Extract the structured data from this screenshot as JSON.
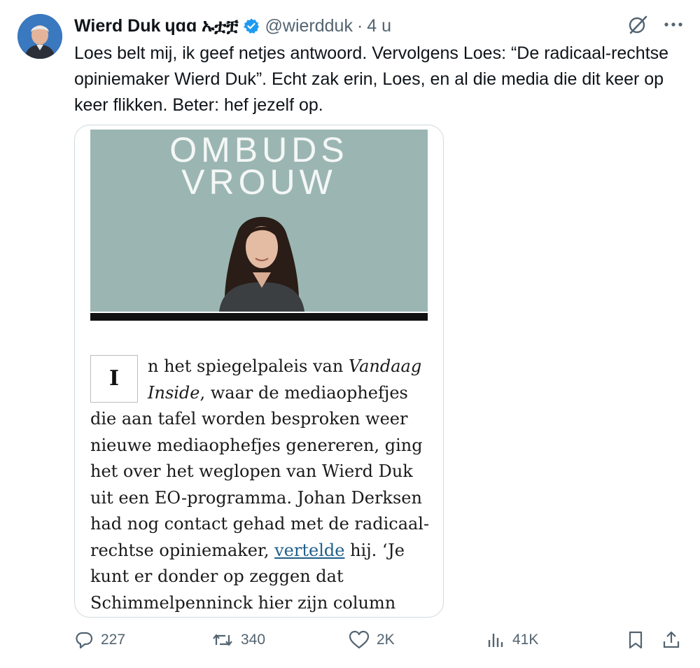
{
  "author": {
    "name": "Wierd Duk",
    "name_extra": "ɥɑɑ ኡቷቿ",
    "handle": "@wierdduk",
    "separator": "·",
    "time": "4 u"
  },
  "tweet": {
    "text": "Loes belt mij, ik geef netjes antwoord. Vervolgens Loes: “De radicaal-rechtse opiniemaker Wierd Duk”. Echt zak erin, Loes, en al die media die dit keer op keer flikken. Beter: hef jezelf op."
  },
  "card": {
    "banner_line1": "OMBUDS",
    "banner_line2": "VROUW",
    "dropcap": "I",
    "para_part1": "n het spiegelpaleis van ",
    "para_italic": "Vandaag Inside",
    "para_part2": ", waar de mediaophefjes die aan tafel worden besproken weer nieuwe mediaophefjes genereren, ging het over het weglopen van Wierd Duk uit een EO-programma. Johan Derksen had nog contact gehad met de radicaal-rechtse opiniemaker, ",
    "para_link": "vertelde",
    "para_part3": " hij. ‘Je kunt er donder op zeggen dat Schimmelpenninck hier zijn column over gaat schrijven’, zou"
  },
  "actions": {
    "replies": "227",
    "reposts": "340",
    "likes": "2K",
    "views": "41K"
  },
  "colors": {
    "text": "#0f1419",
    "secondary": "#536471",
    "verified": "#1d9bf0",
    "banner": "#9bb6b2",
    "link": "#1f5f8a"
  },
  "icons": [
    "verified-badge-icon",
    "grok-icon",
    "more-icon",
    "reply-icon",
    "repost-icon",
    "like-icon",
    "views-icon",
    "bookmark-icon",
    "share-icon"
  ]
}
